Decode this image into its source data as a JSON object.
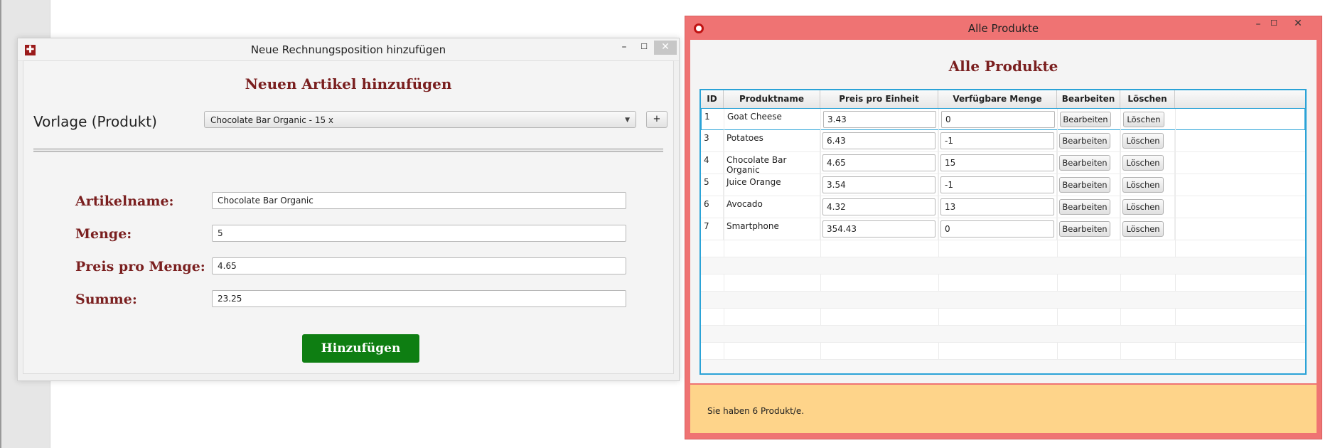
{
  "colors": {
    "window_red": "#ef7373",
    "heading": "#7a1f1f",
    "add_button": "#0e7e12",
    "table_border": "#2ba3d7",
    "footer": "#fed48a"
  },
  "dialog": {
    "title": "Neue Rechnungsposition hinzufügen",
    "icons": {
      "app": "red-plus-icon",
      "minimize": "minimize-icon",
      "maximize": "maximize-icon",
      "close": "close-icon"
    },
    "controls": {
      "minimize": "–",
      "maximize": "☐",
      "close": "✕",
      "app_glyph": "✚"
    },
    "heading": "Neuen Artikel hinzufügen",
    "template_label": "Vorlage (Produkt)",
    "template_value": "Chocolate Bar Organic - 15 x",
    "plus_label": "+",
    "fields": {
      "name_label": "Artikelname:",
      "name_value": "Chocolate Bar Organic",
      "qty_label": "Menge:",
      "qty_value": "5",
      "price_label": "Preis pro Menge:",
      "price_value": "4.65",
      "sum_label": "Summe:",
      "sum_value": "23.25"
    },
    "add_button": "Hinzufügen"
  },
  "products_window": {
    "title": "Alle Produkte",
    "icons": {
      "app": "opera-icon",
      "minimize": "minimize-icon",
      "maximize": "maximize-icon",
      "close": "close-icon"
    },
    "controls": {
      "minimize": "–",
      "maximize": "☐",
      "close": "✕"
    },
    "heading": "Alle Produkte",
    "columns": [
      "ID",
      "Produktname",
      "Preis pro Einheit",
      "Verfügbare Menge",
      "Bearbeiten",
      "Löschen"
    ],
    "rows": [
      {
        "id": "1",
        "name": "Goat Cheese",
        "price": "3.43",
        "qty": "0",
        "edit": "Bearbeiten",
        "delete": "Löschen"
      },
      {
        "id": "3",
        "name": "Potatoes",
        "price": "6.43",
        "qty": "-1",
        "edit": "Bearbeiten",
        "delete": "Löschen"
      },
      {
        "id": "4",
        "name": "Chocolate Bar Organic",
        "price": "4.65",
        "qty": "15",
        "edit": "Bearbeiten",
        "delete": "Löschen"
      },
      {
        "id": "5",
        "name": "Juice Orange",
        "price": "3.54",
        "qty": "-1",
        "edit": "Bearbeiten",
        "delete": "Löschen"
      },
      {
        "id": "6",
        "name": "Avocado",
        "price": "4.32",
        "qty": "13",
        "edit": "Bearbeiten",
        "delete": "Löschen"
      },
      {
        "id": "7",
        "name": "Smartphone",
        "price": "354.43",
        "qty": "0",
        "edit": "Bearbeiten",
        "delete": "Löschen"
      }
    ],
    "footer_text": "Sie haben 6 Produkt/e."
  }
}
